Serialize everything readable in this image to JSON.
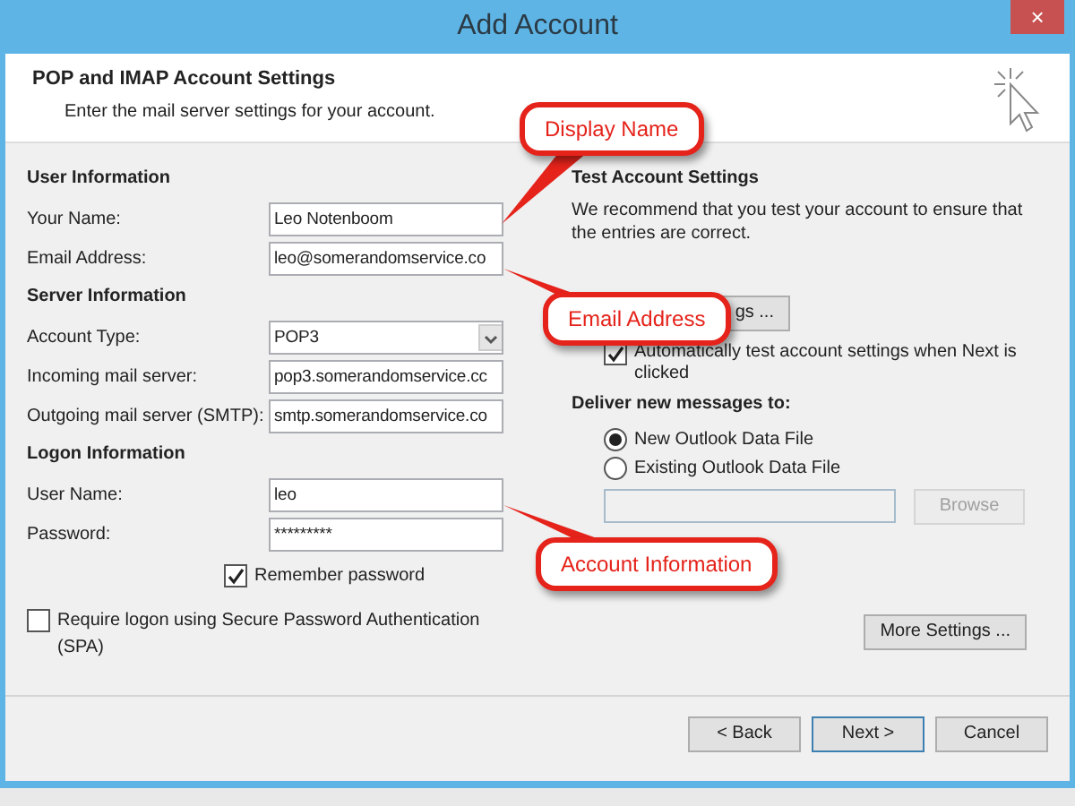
{
  "window": {
    "title": "Add Account",
    "close": "×"
  },
  "header": {
    "title": "POP and IMAP Account Settings",
    "subtitle": "Enter the mail server settings for your account."
  },
  "sections": [
    {
      "heading": "User Information",
      "fields": [
        {
          "label": "Your Name:",
          "kind": "text",
          "value": "Leo Notenboom"
        },
        {
          "label": "Email Address:",
          "kind": "text",
          "value": "leo@somerandomservice.co"
        }
      ]
    },
    {
      "heading": "Server Information",
      "fields": [
        {
          "label": "Account Type:",
          "kind": "select",
          "value": "POP3"
        },
        {
          "label": "Incoming mail server:",
          "kind": "text",
          "value": "pop3.somerandomservice.cc"
        },
        {
          "label": "Outgoing mail server (SMTP):",
          "kind": "text",
          "value": "smtp.somerandomservice.co"
        }
      ]
    },
    {
      "heading": "Logon Information",
      "fields": [
        {
          "label": "User Name:",
          "kind": "text",
          "value": "leo"
        },
        {
          "label": "Password:",
          "kind": "text",
          "value": "*********"
        }
      ]
    }
  ],
  "remember_password": {
    "label": "Remember password",
    "checked": true
  },
  "spa": {
    "label": "Require logon using Secure Password Authentication (SPA)",
    "checked": false
  },
  "test_settings": {
    "heading": "Test Account Settings",
    "text": "We recommend that you test your account to ensure that the entries are correct.",
    "button": "gs ...",
    "auto_test": {
      "label": "Automatically test account settings when Next is clicked",
      "checked": true
    }
  },
  "deliver": {
    "heading": "Deliver new messages to:",
    "options": [
      {
        "label": "New Outlook Data File",
        "selected": true
      },
      {
        "label": "Existing Outlook Data File",
        "selected": false
      }
    ],
    "browse": {
      "label": "Browse",
      "disabled": true
    }
  },
  "more_settings": "More Settings ...",
  "buttons": [
    {
      "label": "< Back",
      "default": false
    },
    {
      "label": "Next >",
      "default": true
    },
    {
      "label": "Cancel",
      "default": false
    }
  ],
  "callouts": [
    {
      "text": "Display Name"
    },
    {
      "text": "Email Address"
    },
    {
      "text": "Account Information"
    }
  ]
}
